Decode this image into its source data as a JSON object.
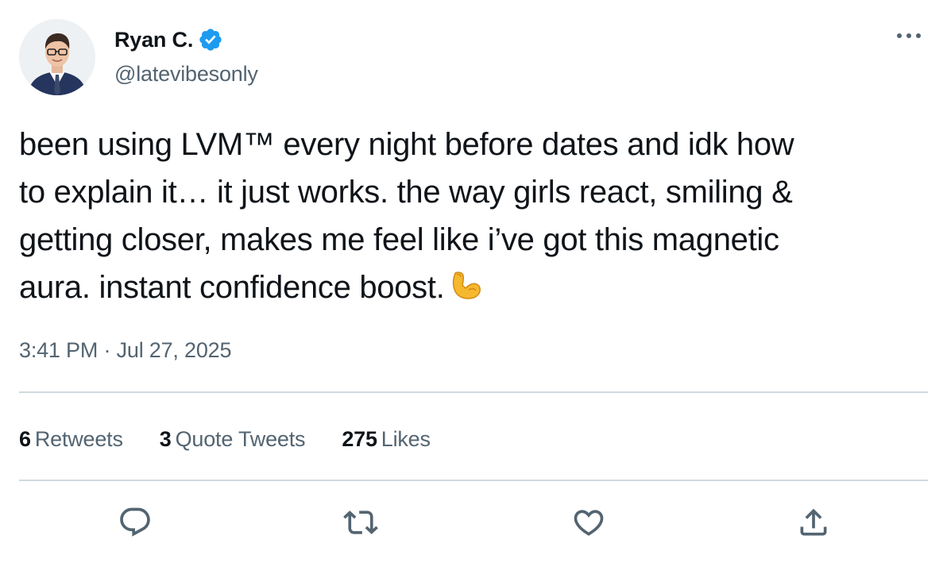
{
  "author": {
    "display_name": "Ryan C.",
    "handle": "@latevibesonly",
    "verified": true,
    "avatar_icon": "avatar-photo-man-glasses-suit",
    "verified_color": "#1d9bf0"
  },
  "tweet": {
    "text_lines": [
      "been using LVM™ every night before dates and idk how",
      "to explain it… it just works. the way girls react, smiling &",
      "getting closer, makes me feel like i’ve got this magnetic",
      "aura. instant confidence boost."
    ],
    "emoji": "flexed-biceps-emoji"
  },
  "meta": {
    "time": "3:41 PM",
    "separator": "·",
    "date": "Jul 27, 2025"
  },
  "stats": {
    "retweets": {
      "count": "6",
      "label": "Retweets"
    },
    "quote_tweets": {
      "count": "3",
      "label": "Quote Tweets"
    },
    "likes": {
      "count": "275",
      "label": "Likes"
    }
  },
  "actions": {
    "reply_icon": "reply-icon",
    "retweet_icon": "retweet-icon",
    "like_icon": "heart-icon",
    "share_icon": "share-icon",
    "icon_color": "#536471"
  },
  "colors": {
    "text": "#0f1419",
    "secondary": "#536471",
    "divider": "#cfd9de"
  }
}
